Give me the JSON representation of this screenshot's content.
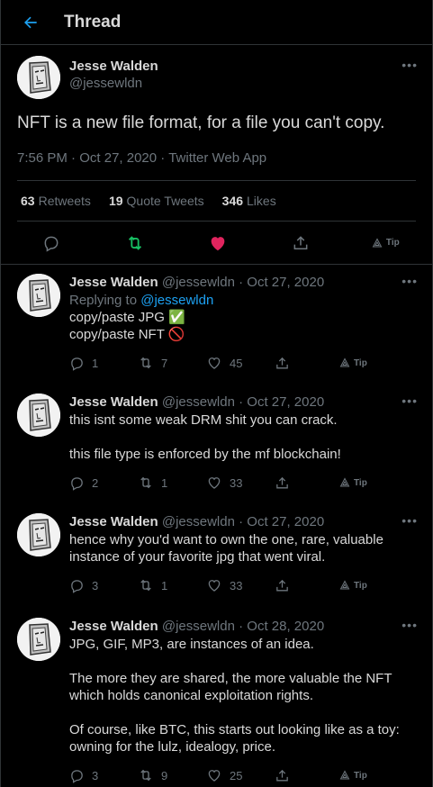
{
  "header": {
    "title": "Thread"
  },
  "main_tweet": {
    "display_name": "Jesse Walden",
    "handle": "@jessewldn",
    "text": "NFT is a new file format, for a file you can't copy.",
    "time": "7:56 PM",
    "date": "Oct 27, 2020",
    "source": "Twitter Web App",
    "stats": {
      "retweets_num": "63",
      "retweets_label": "Retweets",
      "quotes_num": "19",
      "quotes_label": "Quote Tweets",
      "likes_num": "346",
      "likes_label": "Likes"
    },
    "tip_label": "Tip"
  },
  "replies": [
    {
      "display_name": "Jesse Walden",
      "handle": "@jessewldn",
      "date": "Oct 27, 2020",
      "replying_label": "Replying to",
      "replying_to": "@jessewldn",
      "text": "copy/paste JPG ✅\ncopy/paste NFT 🚫",
      "replies": "1",
      "retweets": "7",
      "likes": "45",
      "tip": "Tip"
    },
    {
      "display_name": "Jesse Walden",
      "handle": "@jessewldn",
      "date": "Oct 27, 2020",
      "text": "this isnt some weak DRM shit you can crack.\n\nthis file type is enforced by the mf blockchain!",
      "replies": "2",
      "retweets": "1",
      "likes": "33",
      "tip": "Tip"
    },
    {
      "display_name": "Jesse Walden",
      "handle": "@jessewldn",
      "date": "Oct 27, 2020",
      "text": "hence why you'd want to own the one, rare, valuable instance of your favorite jpg that went viral.",
      "replies": "3",
      "retweets": "1",
      "likes": "33",
      "tip": "Tip"
    },
    {
      "display_name": "Jesse Walden",
      "handle": "@jessewldn",
      "date": "Oct 28, 2020",
      "text": "JPG, GIF, MP3, are instances of an idea.\n\nThe more they are shared, the more valuable the NFT which holds canonical exploitation rights.\n\nOf course, like BTC, this starts out looking like as a toy: owning for the lulz, idealogy, price.",
      "replies": "3",
      "retweets": "9",
      "likes": "25",
      "tip": "Tip"
    }
  ],
  "colors": {
    "accent": "#1da1f2",
    "retweet": "#17bf63",
    "like": "#e0245e",
    "muted": "#6e767d",
    "border": "#2f3336"
  },
  "icons": [
    "back-arrow-icon",
    "more-icon",
    "reply-icon",
    "retweet-icon",
    "like-icon",
    "share-icon",
    "tip-icon"
  ]
}
